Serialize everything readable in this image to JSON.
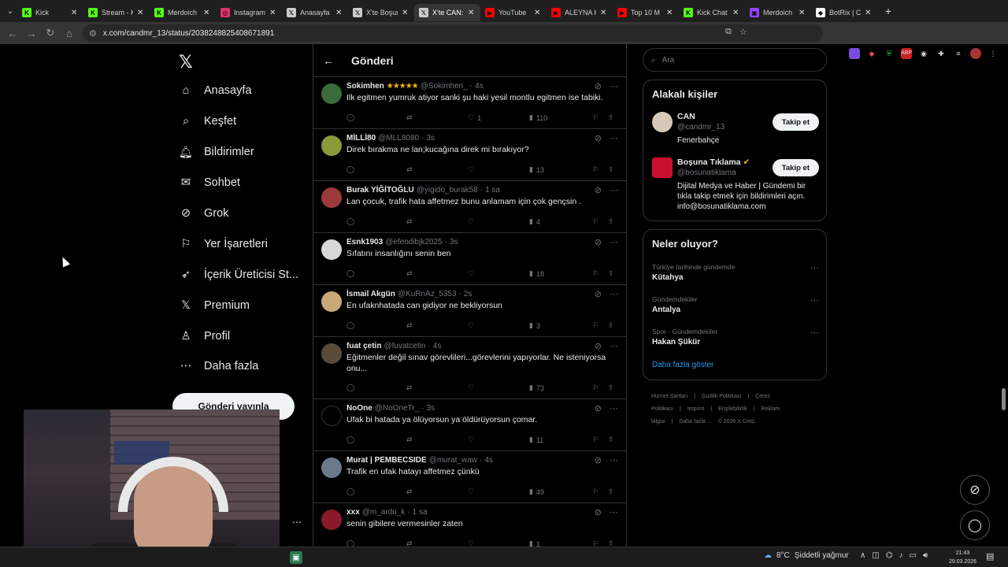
{
  "browser": {
    "tabs": [
      {
        "title": "Kick",
        "icon": "kick-icon",
        "color": "#53fc18",
        "glyph": "K"
      },
      {
        "title": "Stream - K",
        "icon": "kick-icon",
        "color": "#53fc18",
        "glyph": "K"
      },
      {
        "title": "Merdoich",
        "icon": "kick-icon",
        "color": "#53fc18",
        "glyph": "K"
      },
      {
        "title": "Instagram",
        "icon": "instagram-icon",
        "color": "#e1306c",
        "glyph": "◎"
      },
      {
        "title": "Anasayfa /",
        "icon": "x-icon",
        "color": "#cccccc",
        "glyph": "𝕏"
      },
      {
        "title": "X'te Boşun",
        "icon": "x-icon",
        "color": "#cccccc",
        "glyph": "𝕏"
      },
      {
        "title": "X'te CAN:",
        "icon": "x-icon",
        "color": "#cccccc",
        "glyph": "𝕏",
        "active": true
      },
      {
        "title": "YouTube",
        "icon": "youtube-icon",
        "color": "#ff0000",
        "glyph": "▶"
      },
      {
        "title": "ALEYNA K",
        "icon": "youtube-icon",
        "color": "#ff0000",
        "glyph": "▶"
      },
      {
        "title": "Top 10 M",
        "icon": "youtube-icon",
        "color": "#ff0000",
        "glyph": "▶"
      },
      {
        "title": "Kick Chat",
        "icon": "kick-chat-icon",
        "color": "#53fc18",
        "glyph": "K"
      },
      {
        "title": "Merdoich",
        "icon": "twitch-icon",
        "color": "#9146ff",
        "glyph": "▣"
      },
      {
        "title": "BotRix | C",
        "icon": "botrix-icon",
        "color": "#ffffff",
        "glyph": "◆"
      }
    ],
    "url": "x.com/candmr_13/status/2038248825408671891"
  },
  "nav": {
    "items": [
      {
        "label": "Anasayfa",
        "icon": "home-icon",
        "glyph": "⌂"
      },
      {
        "label": "Keşfet",
        "icon": "search-icon",
        "glyph": "⌕"
      },
      {
        "label": "Bildirimler",
        "icon": "bell-icon",
        "glyph": "🔔︎"
      },
      {
        "label": "Sohbet",
        "icon": "mail-icon",
        "glyph": "✉"
      },
      {
        "label": "Grok",
        "icon": "grok-icon",
        "glyph": "⊘"
      },
      {
        "label": "Yer İşaretleri",
        "icon": "bookmark-icon",
        "glyph": "⚐"
      },
      {
        "label": "İçerik Üreticisi St...",
        "icon": "rocket-icon",
        "glyph": "➶"
      },
      {
        "label": "Premium",
        "icon": "x-logo-icon",
        "glyph": "𝕏"
      },
      {
        "label": "Profil",
        "icon": "person-icon",
        "glyph": "♙"
      },
      {
        "label": "Daha fazla",
        "icon": "more-circle-icon",
        "glyph": "⋯"
      }
    ],
    "post_button": "Gönderi yayınla"
  },
  "center": {
    "title": "Gönderi",
    "tweets": [
      {
        "name": "Sokimhen",
        "stars": "★★★★★",
        "handle": "@Sokimhen_",
        "time": "4s",
        "text": "Ilk egitmen yumruk atiyor sanki şu haki yesil montlu egitmen ise tabiki.",
        "replies": "",
        "reposts": "",
        "likes": "1",
        "views": "110",
        "avatar_color": "#3a6b3a"
      },
      {
        "name": "MİLLİ80",
        "stars": "",
        "handle": "@MLL8080",
        "time": "3s",
        "text": "Direk bırakma ne lan;kucağına direk mi bırakıyor?",
        "replies": "",
        "reposts": "",
        "likes": "",
        "views": "13",
        "avatar_color": "#8a9a3a"
      },
      {
        "name": "Burak YİĞİTOĞLU",
        "stars": "",
        "handle": "@yigido_burak58",
        "time": "1 sa",
        "text": "Lan çocuk, trafik hata affetmez bunu anlamam için çok gençsin .",
        "replies": "",
        "reposts": "",
        "likes": "",
        "views": "4",
        "avatar_color": "#9a3a3a"
      },
      {
        "name": "Esnk1903",
        "stars": "",
        "handle": "@efendibjk2025",
        "time": "3s",
        "text": "Sıfatını insanlığını senin ben",
        "replies": "",
        "reposts": "",
        "likes": "",
        "views": "18",
        "avatar_color": "#d8d8d8"
      },
      {
        "name": "İsmail Akgün",
        "stars": "",
        "handle": "@KuRnAz_5353",
        "time": "2s",
        "text": "En ufaknhatada can gidiyor ne bekliyorsun",
        "replies": "",
        "reposts": "",
        "likes": "",
        "views": "3",
        "avatar_color": "#c8a878"
      },
      {
        "name": "fuat çetin",
        "stars": "",
        "handle": "@fuvatcetin",
        "time": "4s",
        "text": "Eğitmenler değil sınav görevlileri...görevlerini yapıyorlar. Ne isteniyorsa onu...",
        "replies": "",
        "reposts": "",
        "likes": "",
        "views": "73",
        "avatar_color": "#5a4a3a"
      },
      {
        "name": "NoOne",
        "stars": "",
        "handle": "@NoOneTr_",
        "time": "3s",
        "text": "Ufak bi hatada ya ölüyorsun ya öldürüyorsun çomar.",
        "replies": "",
        "reposts": "",
        "likes": "",
        "views": "11",
        "avatar_color": "#000000"
      },
      {
        "name": "Murat | PEMBECSIDE",
        "stars": "",
        "handle": "@murat_waw",
        "time": "4s",
        "text": "Trafik en ufak hatayı affetmez çünkü",
        "replies": "",
        "reposts": "",
        "likes": "",
        "views": "49",
        "avatar_color": "#6a7a8a"
      },
      {
        "name": "xxx",
        "stars": "",
        "handle": "@m_ardu_k",
        "time": "1 sa",
        "text": "senin gibilere vermesinler zaten",
        "replies": "",
        "reposts": "",
        "likes": "",
        "views": "1",
        "avatar_color": "#8a1a2a"
      }
    ]
  },
  "right": {
    "search_placeholder": "Ara",
    "people_title": "Alakalı kişiler",
    "people": [
      {
        "name": "CAN",
        "handle": "@candmr_13",
        "bio": "Fenerbahçe",
        "follow": "Takip et",
        "avatar_color": "#d8c8b8",
        "verified": false
      },
      {
        "name": "Boşuna Tıklama",
        "handle": "@bosunatiklama",
        "bio": "Dijital Medya ve Haber | Gündemi bir tıkla takip etmek için bildirimleri açın. info@bosunatiklama.com",
        "follow": "Takip et",
        "avatar_color": "#c8102e",
        "verified": true
      }
    ],
    "trends_title": "Neler oluyor?",
    "trends": [
      {
        "category": "Türkiye tarihinde gündemde",
        "name": "Kütahya"
      },
      {
        "category": "Gündemdekiler",
        "name": "Antalya"
      },
      {
        "category": "Spor · Gündemdekiler",
        "name": "Hakan Şükür"
      }
    ],
    "show_more": "Daha fazla göster",
    "footer": [
      "Hizmet Şartları",
      "|",
      "Gizlilik Politikası",
      "|",
      "Çerez Politikası",
      "|",
      "Imprint",
      "|",
      "Erişilebilirlik",
      "|",
      "Reklam bilgisi",
      "|",
      "Daha fazla ...",
      "© 2026 X Corp."
    ]
  },
  "taskbar": {
    "weather_temp": "8°C",
    "weather_text": "Şiddetli yağmur",
    "time": "21:43",
    "date": "29.03.2026"
  },
  "colors": {
    "accent": "#1d9bf0",
    "verified": "#e2b719"
  }
}
